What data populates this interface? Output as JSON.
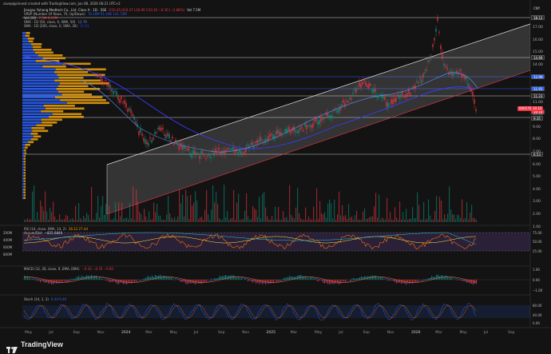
{
  "attribution": "savepigsinvest created with TradingView.com, Jun 08, 2026 06:21 UTC+2",
  "symbol_line": {
    "name": "Jiangsu Yuhong Medtech Co., Ltd. Class A · 1D · SSE",
    "ohlc": "O10.45 H10.47 L10.09 C10.10 −0.30 (−2.88%)",
    "vol": "Vol 7.5M"
  },
  "indicators_main": [
    {
      "label": "VRVP (Number Of Rows, 70, Up/Down)",
      "values": "78.16M 61.44K 141.72M"
    },
    {
      "label": "Vol (20)",
      "values": "7.5M 9.21M"
    },
    {
      "label": "SMA · 1D (50, close, 0, SMA, 50)",
      "values": "12.79"
    },
    {
      "label": "SMA · 1D (200, close, 0, SMA, 30)",
      "values": "11.91"
    }
  ],
  "currency": "CNY",
  "price_axis_ticks": [
    "17.00",
    "16.00",
    "15.00",
    "14.00",
    "13.00",
    "12.00",
    "11.00",
    "10.00",
    "9.00",
    "8.00",
    "7.00",
    "6.00",
    "5.00",
    "4.00",
    "3.00",
    "2.00",
    "1.00"
  ],
  "price_tags": [
    {
      "text": "18.12",
      "color": "#2a2a2a"
    },
    {
      "text": "14.69",
      "color": "#2a2a2a"
    },
    {
      "text": "12.99",
      "color": "#2962ff"
    },
    {
      "text": "11.91",
      "color": "#2962ff"
    },
    {
      "text": "11.23",
      "color": "#2a2a2a"
    },
    {
      "text": "10.10",
      "color": "#f23645"
    },
    {
      "text": "9.35",
      "color": "#2a2a2a"
    },
    {
      "text": "6.53",
      "color": "#2a2a2a"
    }
  ],
  "last_price_tag": "600176",
  "last_price_countdown": "10.10",
  "rsi_panel": {
    "label": "RSI (14, close, SMA, 14, 2)",
    "values": "28.12 27.44",
    "accum_label": "Accum/Dist",
    "accum_value": "−825.684K",
    "left_ticks": [
      "200M",
      "400M",
      "600M",
      "800M"
    ],
    "right_ticks": [
      "75.00",
      "50.00",
      "25.00"
    ]
  },
  "macd_panel": {
    "label": "MACD (12, 26, close, 9, EMA, EMA)",
    "values": "−0.16  −0.76  −0.60",
    "right_ticks": [
      "1.00",
      "0.00",
      "−1.00"
    ]
  },
  "stoch_panel": {
    "label": "Stoch (14, 1, 3)",
    "values": "8.34 9.46",
    "right_ticks": [
      "80.00",
      "40.00",
      "0.00"
    ]
  },
  "x_axis": [
    "May",
    "Jul",
    "Sep",
    "Nov",
    "2024",
    "Mar",
    "May",
    "Jul",
    "Sep",
    "Nov",
    "2025",
    "Mar",
    "May",
    "Jul",
    "Sep",
    "Nov",
    "2026",
    "Mar",
    "May",
    "Jul",
    "Sep"
  ],
  "brand": "TradingView",
  "colors": {
    "background": "#131313",
    "up": "#089981",
    "down": "#f23645",
    "sma50": "#5b8def",
    "sma200": "#3a3aff",
    "channel": "#e6e6e6",
    "vrvp_up": "#2962ff",
    "vrvp_down": "#f0a30a"
  }
}
